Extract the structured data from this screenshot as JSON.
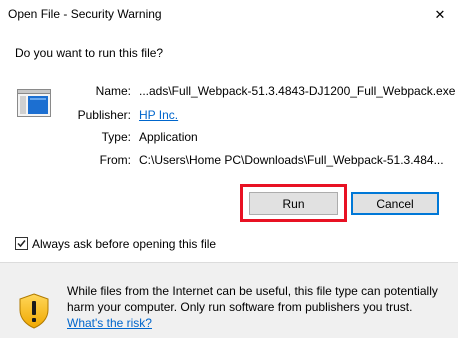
{
  "dialog": {
    "title": "Open File - Security Warning",
    "close_glyph": "✕",
    "question": "Do you want to run this file?"
  },
  "file": {
    "icon": "application-window-icon",
    "name_label": "Name:",
    "name_value": "...ads\\Full_Webpack-51.3.4843-DJ1200_Full_Webpack.exe",
    "publisher_label": "Publisher:",
    "publisher_value": "HP Inc.",
    "type_label": "Type:",
    "type_value": "Application",
    "from_label": "From:",
    "from_value": "C:\\Users\\Home PC\\Downloads\\Full_Webpack-51.3.484..."
  },
  "buttons": {
    "run": "Run",
    "cancel": "Cancel"
  },
  "checkbox": {
    "label": "Always ask before opening this file",
    "checked": true
  },
  "footer": {
    "icon": "shield-warning-icon",
    "warning_text": "While files from the Internet can be useful, this file type can potentially harm your computer. Only run software from publishers you trust.",
    "risk_link": "What's the risk?"
  },
  "colors": {
    "highlight": "#e81123",
    "link": "#0066cc",
    "accent": "#0078d7"
  }
}
